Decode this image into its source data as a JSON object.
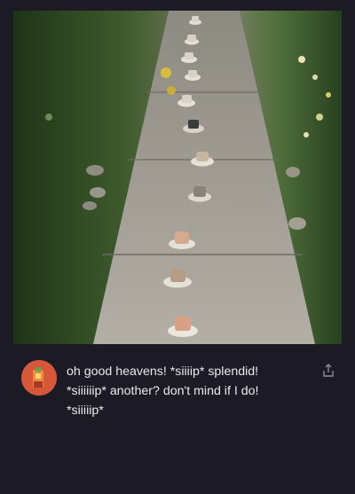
{
  "post": {
    "text_lines": [
      "oh good heavens! *siiiip* splendid!",
      "*siiiiiip* another? don't mind if I do!",
      "*siiiiip*"
    ]
  },
  "icons": {
    "avatar": "tea-cup-avatar",
    "share": "share-icon"
  },
  "colors": {
    "background": "#1b1a25",
    "text": "#e9e9ef",
    "avatar": "#d6573a"
  }
}
